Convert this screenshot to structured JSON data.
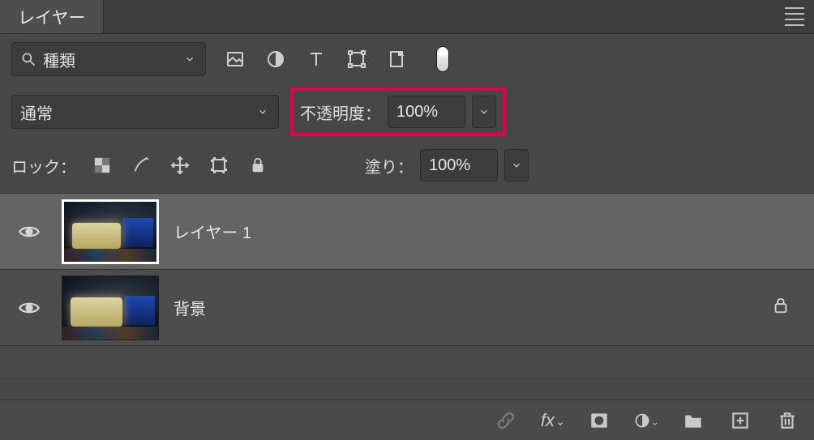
{
  "tab": {
    "title": "レイヤー"
  },
  "filter": {
    "search_label": "種類",
    "icons": {
      "pixel": "image-icon",
      "adjust": "adjust-icon",
      "text": "text-icon",
      "shape": "shape-icon",
      "smart": "smartobject-icon"
    }
  },
  "blend": {
    "mode": "通常",
    "opacity_label": "不透明度：",
    "opacity_value": "100%"
  },
  "lock": {
    "label": "ロック：",
    "fill_label": "塗り：",
    "fill_value": "100%"
  },
  "layers": [
    {
      "name": "レイヤー 1",
      "selected": true,
      "locked": false
    },
    {
      "name": "背景",
      "selected": false,
      "locked": true
    }
  ],
  "footer": {
    "icons": {
      "link": "link-icon",
      "fx": "fx-icon",
      "mask": "mask-icon",
      "fill": "fill-adjust-icon",
      "group": "group-icon",
      "new": "new-layer-icon",
      "trash": "trash-icon"
    }
  }
}
